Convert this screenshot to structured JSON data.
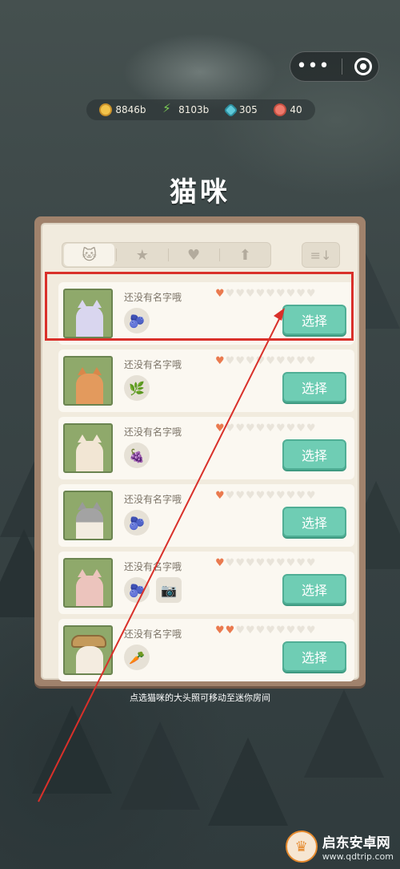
{
  "currencies": [
    {
      "icon": "coin-icon",
      "value": "8846b"
    },
    {
      "icon": "lightning-icon",
      "value": "8103b"
    },
    {
      "icon": "gem-icon",
      "value": "305"
    },
    {
      "icon": "heart-token-icon",
      "value": "40"
    }
  ],
  "title": "猫咪",
  "tabs": [
    {
      "icon": "cat-icon",
      "active": true
    },
    {
      "icon": "star-icon",
      "active": false
    },
    {
      "icon": "heart-icon",
      "active": false
    },
    {
      "icon": "up-arrow-icon",
      "active": false
    }
  ],
  "sort_icon": "sort-icon",
  "cats": [
    {
      "name": "还没有名字哦",
      "hearts_filled": 1,
      "hearts_total": 10,
      "items": [
        "berries-icon"
      ],
      "button": "选择",
      "highlighted": true
    },
    {
      "name": "还没有名字哦",
      "hearts_filled": 1,
      "hearts_total": 10,
      "items": [
        "plant-icon"
      ],
      "button": "选择"
    },
    {
      "name": "还没有名字哦",
      "hearts_filled": 1,
      "hearts_total": 10,
      "items": [
        "grapes-icon"
      ],
      "button": "选择"
    },
    {
      "name": "还没有名字哦",
      "hearts_filled": 1,
      "hearts_total": 10,
      "items": [
        "berries-icon"
      ],
      "button": "选择"
    },
    {
      "name": "还没有名字哦",
      "hearts_filled": 1,
      "hearts_total": 10,
      "items": [
        "berries-icon",
        "camera-icon"
      ],
      "button": "选择"
    },
    {
      "name": "还没有名字哦",
      "hearts_filled": 2,
      "hearts_total": 10,
      "items": [
        "carrot-icon"
      ],
      "button": "选择"
    }
  ],
  "hint": "点选猫咪的大头照可移动至迷你房间",
  "watermark": {
    "name": "启东安卓网",
    "url": "www.qdtrip.com"
  },
  "colors": {
    "accent_button": "#6fcdb4",
    "heart_filled": "#ea7a4f",
    "highlight_box": "#d9302a"
  }
}
